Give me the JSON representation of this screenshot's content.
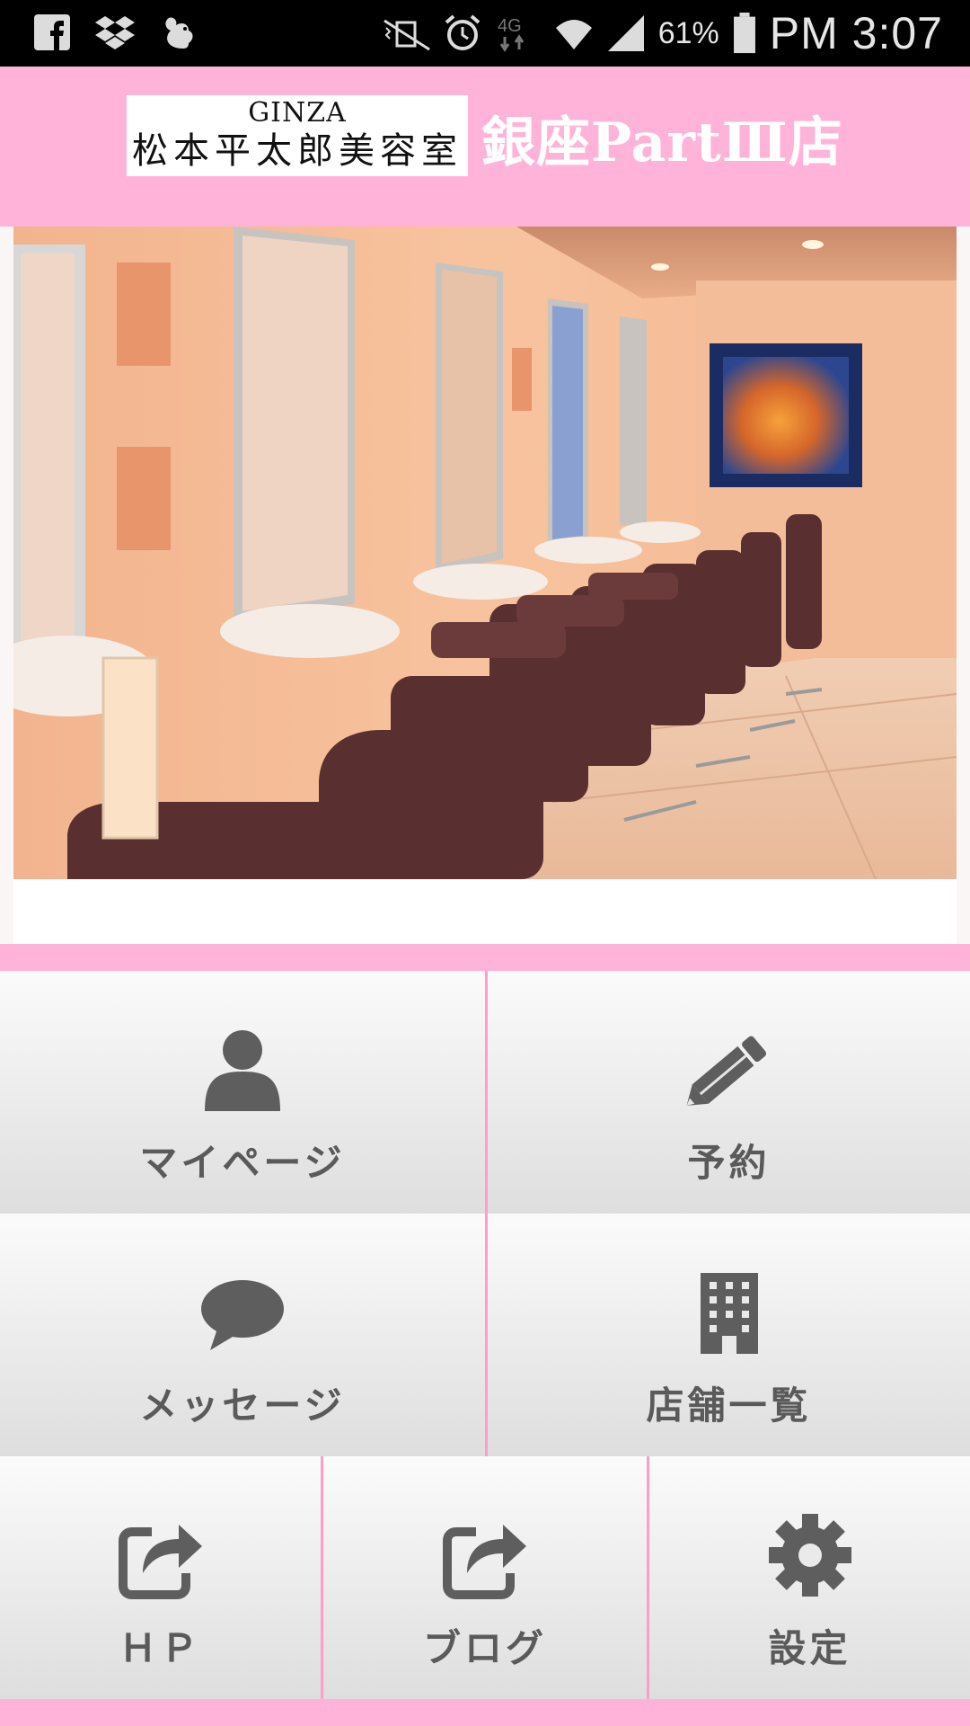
{
  "status_bar": {
    "battery": "61%",
    "time": "PM 3:07",
    "icons_left": [
      "facebook-icon",
      "dropbox-icon",
      "squirrel-icon"
    ],
    "icons_right": [
      "mute-vibrate-icon",
      "alarm-icon",
      "4g-icon",
      "wifi-icon",
      "signal-icon",
      "battery-icon"
    ]
  },
  "header": {
    "logo_top": "GINZA",
    "logo_bottom": "松本平太郎美容室",
    "store_name": "銀座PartⅢ店",
    "background": "#ffb3d8"
  },
  "hero": {
    "alt": "salon interior"
  },
  "menu": {
    "mypage": {
      "label": "マイページ",
      "icon": "person-icon"
    },
    "reserve": {
      "label": "予約",
      "icon": "pencil-icon"
    },
    "message": {
      "label": "メッセージ",
      "icon": "speech-bubble-icon"
    },
    "stores": {
      "label": "店舗一覧",
      "icon": "building-icon"
    },
    "hp": {
      "label": "ＨＰ",
      "icon": "share-icon"
    },
    "blog": {
      "label": "ブログ",
      "icon": "share-icon"
    },
    "settings": {
      "label": "設定",
      "icon": "gear-icon"
    }
  }
}
